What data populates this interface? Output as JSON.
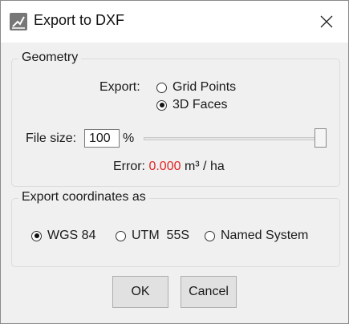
{
  "dialog": {
    "title": "Export to DXF",
    "icon": "app-icon"
  },
  "geometry": {
    "group_title": "Geometry",
    "export_label": "Export:",
    "options": [
      {
        "label": "Grid Points",
        "selected": false
      },
      {
        "label": "3D Faces",
        "selected": true
      }
    ],
    "file_size_label": "File size:",
    "file_size_value": "100",
    "file_size_unit": "%",
    "slider_fraction": 1.0,
    "error_label": "Error:",
    "error_value": "0.000",
    "error_unit": "m³ / ha",
    "error_color": "#e02424"
  },
  "coordinates": {
    "group_title": "Export coordinates as",
    "options": [
      {
        "label": "WGS 84",
        "selected": true
      },
      {
        "label": "UTM  55S",
        "selected": false
      },
      {
        "label": "Named System",
        "selected": false
      }
    ]
  },
  "buttons": {
    "ok": "OK",
    "cancel": "Cancel"
  }
}
